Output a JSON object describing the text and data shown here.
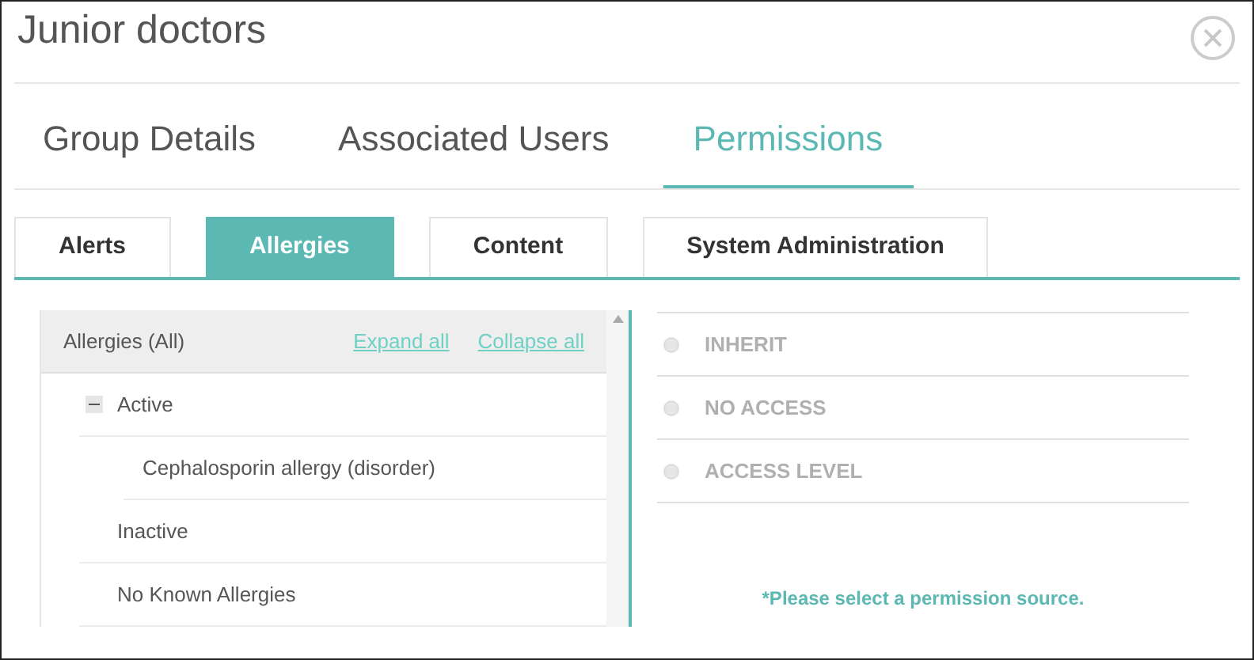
{
  "window": {
    "title": "Junior doctors"
  },
  "tabs": [
    {
      "label": "Group Details",
      "selected": false
    },
    {
      "label": "Associated Users",
      "selected": false
    },
    {
      "label": "Permissions",
      "selected": true
    }
  ],
  "subtabs": [
    {
      "label": "Alerts",
      "selected": false
    },
    {
      "label": "Allergies",
      "selected": true
    },
    {
      "label": "Content",
      "selected": false
    },
    {
      "label": "System Administration",
      "selected": false
    }
  ],
  "tree": {
    "header": "Allergies (All)",
    "expand_link": "Expand all",
    "collapse_link": "Collapse all",
    "items": [
      {
        "label": "Active",
        "expanded": true,
        "children": [
          {
            "label": "Cephalosporin allergy (disorder)"
          }
        ]
      },
      {
        "label": "Inactive"
      },
      {
        "label": "No Known Allergies"
      }
    ]
  },
  "permission_options": [
    {
      "label": "INHERIT",
      "selected": false,
      "disabled": true
    },
    {
      "label": "NO ACCESS",
      "selected": false,
      "disabled": true
    },
    {
      "label": "ACCESS LEVEL",
      "selected": false,
      "disabled": true
    }
  ],
  "hint": "*Please select a permission source."
}
